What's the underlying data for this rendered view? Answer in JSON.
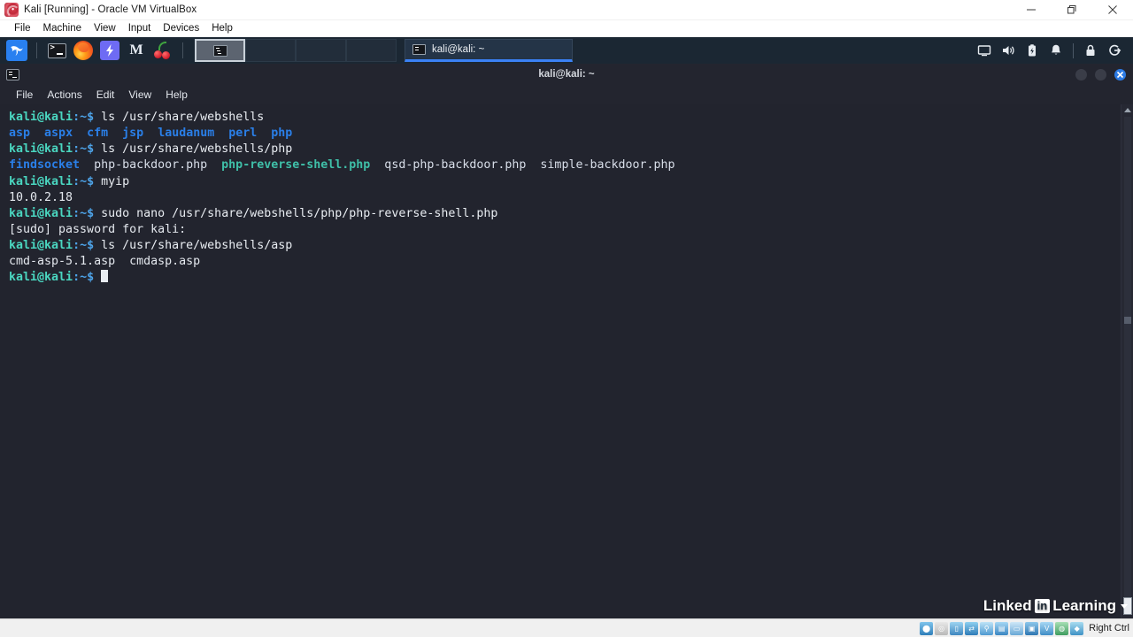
{
  "vbox": {
    "title": "Kali [Running] - Oracle VM VirtualBox",
    "icon": "virtualbox-kali-icon",
    "menu": [
      "File",
      "Machine",
      "View",
      "Input",
      "Devices",
      "Help"
    ],
    "window_controls": {
      "minimize": "minimize-icon",
      "restore": "restore-icon",
      "close": "close-icon"
    },
    "statusbar": {
      "host_key": "Right Ctrl",
      "indicators": [
        "hard-disk-icon",
        "optical-drive-icon",
        "floppy-drive-icon",
        "network-icon",
        "usb-icon",
        "shared-folders-icon",
        "display-icon",
        "recording-icon",
        "vrde-icon",
        "mouse-integration-icon",
        "host-key-icon"
      ]
    }
  },
  "kali_panel": {
    "launchers": [
      {
        "name": "kali-menu-icon",
        "label": "Kali Menu"
      },
      {
        "name": "terminal-icon",
        "label": "Terminal"
      },
      {
        "name": "firefox-icon",
        "label": "Firefox ESR"
      },
      {
        "name": "burpsuite-icon",
        "label": "Burp Suite"
      },
      {
        "name": "metasploit-icon",
        "label": "Metasploit Framework",
        "glyph": "M"
      },
      {
        "name": "cherrytree-icon",
        "label": "CherryTree"
      }
    ],
    "workspaces": [
      {
        "name": "workspace-1",
        "active": true
      },
      {
        "name": "workspace-2",
        "active": false
      },
      {
        "name": "workspace-3",
        "active": false
      },
      {
        "name": "workspace-4",
        "active": false
      }
    ],
    "tasks": [
      {
        "name": "taskbar-terminal-button",
        "label": "kali@kali: ~",
        "active": true
      }
    ],
    "tray": [
      "display-settings-icon",
      "volume-icon",
      "battery-icon",
      "notification-bell-icon",
      "lock-screen-icon",
      "logout-icon"
    ]
  },
  "terminal": {
    "title": "kali@kali: ~",
    "icon": "terminal-window-icon",
    "menu": [
      "File",
      "Actions",
      "Edit",
      "View",
      "Help"
    ],
    "window_controls": {
      "minimize": "minimize-circle-icon",
      "maximize": "maximize-circle-icon",
      "close": "close-circle-icon"
    },
    "prompt": {
      "user_host": "kali@kali",
      "path": ":~",
      "symbol": "$"
    },
    "lines": [
      {
        "type": "prompt",
        "command": " ls /usr/share/webshells"
      },
      {
        "type": "output",
        "segments": [
          {
            "text": "asp",
            "style": "dir"
          },
          {
            "text": "  ",
            "style": "plain"
          },
          {
            "text": "aspx",
            "style": "dir"
          },
          {
            "text": "  ",
            "style": "plain"
          },
          {
            "text": "cfm",
            "style": "dir"
          },
          {
            "text": "  ",
            "style": "plain"
          },
          {
            "text": "jsp",
            "style": "dir"
          },
          {
            "text": "  ",
            "style": "plain"
          },
          {
            "text": "laudanum",
            "style": "dir"
          },
          {
            "text": "  ",
            "style": "plain"
          },
          {
            "text": "perl",
            "style": "dir"
          },
          {
            "text": "  ",
            "style": "plain"
          },
          {
            "text": "php",
            "style": "dir"
          }
        ]
      },
      {
        "type": "prompt",
        "command": " ls /usr/share/webshells/php"
      },
      {
        "type": "output",
        "segments": [
          {
            "text": "findsocket",
            "style": "dir"
          },
          {
            "text": "  php-backdoor.php  ",
            "style": "file"
          },
          {
            "text": "php-reverse-shell.php",
            "style": "exec"
          },
          {
            "text": "  qsd-php-backdoor.php  simple-backdoor.php",
            "style": "file"
          }
        ]
      },
      {
        "type": "prompt",
        "command": " myip"
      },
      {
        "type": "output",
        "segments": [
          {
            "text": "10.0.2.18",
            "style": "plain"
          }
        ]
      },
      {
        "type": "prompt",
        "command": " sudo nano /usr/share/webshells/php/php-reverse-shell.php"
      },
      {
        "type": "output",
        "segments": [
          {
            "text": "[sudo] password for kali:",
            "style": "plain"
          }
        ]
      },
      {
        "type": "prompt",
        "command": " ls /usr/share/webshells/asp"
      },
      {
        "type": "output",
        "segments": [
          {
            "text": "cmd-asp-5.1.asp  cmdasp.asp",
            "style": "plain"
          }
        ]
      },
      {
        "type": "prompt",
        "command": " ",
        "cursor": true
      }
    ]
  },
  "watermark": {
    "part1": "Linked",
    "part2": "in",
    "part3": "Learning"
  },
  "colors": {
    "terminal_bg": "#22242e",
    "panel_bg": "#1b2733",
    "prompt_user": "#4ad6c0",
    "prompt_path": "#4da3e8",
    "directory": "#2a7fe8",
    "executable": "#3fbfa8",
    "text": "#d8dee9",
    "accent": "#2c7be5"
  }
}
